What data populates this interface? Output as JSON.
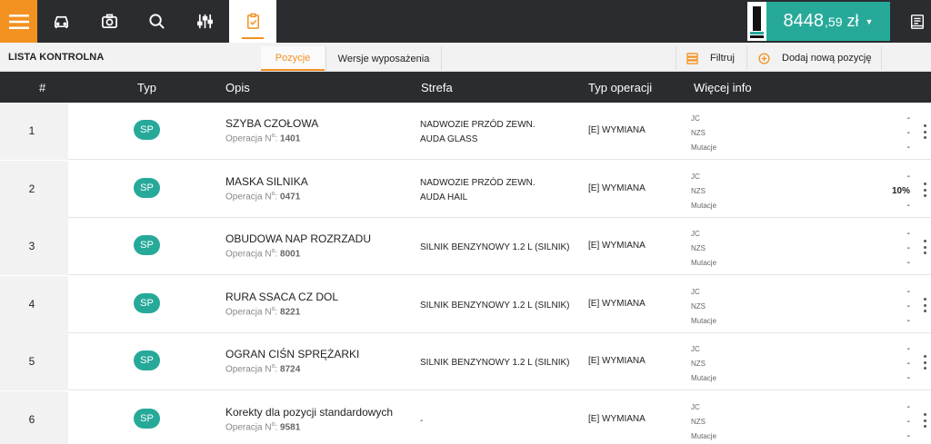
{
  "topbar": {
    "price": {
      "main": "8448",
      "decimals": ",59",
      "currency": "zł"
    }
  },
  "subbar": {
    "title": "LISTA KONTROLNA",
    "tabs": [
      "Pozycje",
      "Wersje wyposażenia"
    ],
    "filter_label": "Filtruj",
    "add_label": "Dodaj nową pozycję"
  },
  "table": {
    "headers": [
      "#",
      "Typ",
      "Opis",
      "Strefa",
      "Typ operacji",
      "Więcej info"
    ],
    "more_labels": [
      "JC",
      "NZS",
      "Mutacje"
    ],
    "op_prefix": "Operacja N",
    "rows": [
      {
        "num": "1",
        "typ": "SP",
        "opis": "SZYBA CZOŁOWA",
        "op": "1401",
        "strefa": [
          "NADWOZIE PRZÓD ZEWN.",
          "AUDA GLASS"
        ],
        "typ_op": "[E] WYMIANA",
        "values": [
          "-",
          "-",
          "-"
        ]
      },
      {
        "num": "2",
        "typ": "SP",
        "opis": "MASKA SILNIKA",
        "op": "0471",
        "strefa": [
          "NADWOZIE PRZÓD ZEWN.",
          "AUDA HAIL"
        ],
        "typ_op": "[E] WYMIANA",
        "values": [
          "-",
          "10%",
          "-"
        ]
      },
      {
        "num": "3",
        "typ": "SP",
        "opis": "OBUDOWA NAP ROZRZADU",
        "op": "8001",
        "strefa": [
          "SILNIK BENZYNOWY 1.2 L (SILNIK)"
        ],
        "typ_op": "[E] WYMIANA",
        "values": [
          "-",
          "-",
          "-"
        ]
      },
      {
        "num": "4",
        "typ": "SP",
        "opis": "RURA SSACA CZ DOL",
        "op": "8221",
        "strefa": [
          "SILNIK BENZYNOWY 1.2 L (SILNIK)"
        ],
        "typ_op": "[E] WYMIANA",
        "values": [
          "-",
          "-",
          "-"
        ]
      },
      {
        "num": "5",
        "typ": "SP",
        "opis": "OGRAN CIŚN SPRĘŻARKI",
        "op": "8724",
        "strefa": [
          "SILNIK BENZYNOWY 1.2 L (SILNIK)"
        ],
        "typ_op": "[E] WYMIANA",
        "values": [
          "-",
          "-",
          "-"
        ]
      },
      {
        "num": "6",
        "typ": "SP",
        "opis": "Korekty dla pozycji standardowych",
        "op": "9581",
        "strefa": [
          "-"
        ],
        "typ_op": "[E] WYMIANA",
        "values": [
          "-",
          "-",
          "-"
        ]
      }
    ]
  },
  "colors": {
    "accent": "#f39121",
    "teal": "#27a99a",
    "dark": "#2b2c30"
  },
  "icons": [
    "hamburger-icon",
    "car-icon",
    "camera-icon",
    "search-icon",
    "sliders-icon",
    "clipboard-check-icon",
    "receipt-icon",
    "filter-icon",
    "add-circle-icon",
    "kebab-icon"
  ]
}
